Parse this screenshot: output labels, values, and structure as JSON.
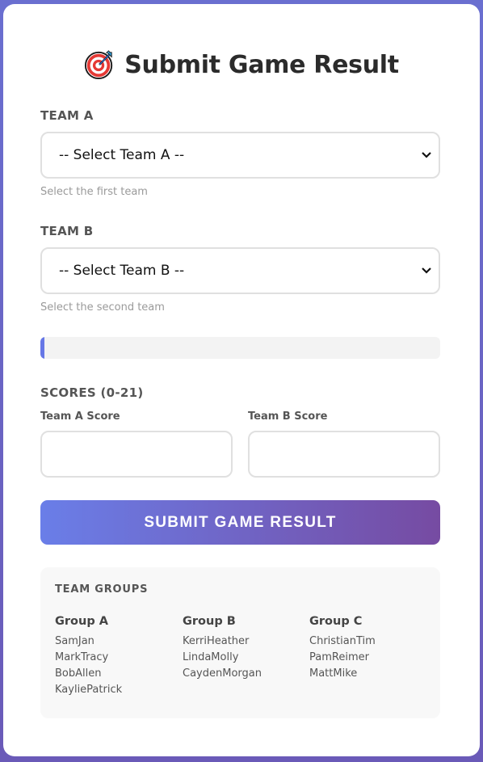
{
  "header": {
    "title": "Submit Game Result",
    "icon": "target-icon"
  },
  "team_a": {
    "label": "TEAM A",
    "selected": "-- Select Team A --",
    "help": "Select the first team"
  },
  "team_b": {
    "label": "TEAM B",
    "selected": "-- Select Team B --",
    "help": "Select the second team"
  },
  "progress": {
    "fraction": 0.01
  },
  "scores": {
    "label": "SCORES (0-21)",
    "team_a_label": "Team A Score",
    "team_b_label": "Team B Score",
    "team_a_value": "",
    "team_b_value": ""
  },
  "submit_label": "SUBMIT GAME RESULT",
  "groups": {
    "heading": "TEAM GROUPS",
    "list": [
      {
        "name": "Group A",
        "teams": [
          "SamJan",
          "MarkTracy",
          "BobAllen",
          "KayliePatrick"
        ]
      },
      {
        "name": "Group B",
        "teams": [
          "KerriHeather",
          "LindaMolly",
          "CaydenMorgan"
        ]
      },
      {
        "name": "Group C",
        "teams": [
          "ChristianTim",
          "PamReimer",
          "MattMike"
        ]
      }
    ]
  },
  "colors": {
    "accent_start": "#667eea",
    "accent_end": "#764ba2",
    "background": "#6a62c4"
  }
}
